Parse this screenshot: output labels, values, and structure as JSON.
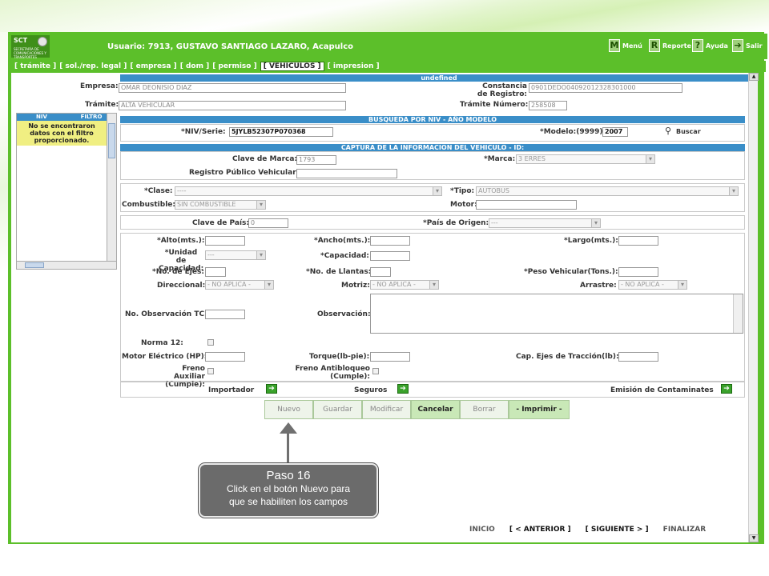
{
  "header": {
    "logo_text": "SCT",
    "logo_sub": "SECRETARÍA DE COMUNICACIONES Y TRANSPORTES",
    "user_text": "Usuario: 7913, GUSTAVO SANTIAGO LAZARO, Acapulco",
    "buttons": [
      {
        "icon": "M",
        "label": "Menú"
      },
      {
        "icon": "R",
        "label": "Reporte"
      },
      {
        "icon": "?",
        "label": "Ayuda"
      },
      {
        "icon": "➔",
        "label": "Salir"
      }
    ]
  },
  "tabs": [
    "[ trámite ]",
    "[ sol./rep. legal ]",
    "[ empresa ]",
    "[ dom ]",
    "[ permiso ]",
    "[ VEHICULOS ]",
    "[ impresion ]"
  ],
  "active_tab": "[ VEHICULOS ]",
  "undefined_bar": "undefined",
  "top": {
    "empresa_label": "Empresa:",
    "empresa_value": "OMAR DEONISIO DIAZ",
    "tramite_label": "Trámite:",
    "tramite_value": "ALTA VEHICULAR",
    "constancia_label": "Constancia de Registro:",
    "constancia_value": "0901DEDO04092012328301000",
    "tramite_num_label": "Trámite Número:",
    "tramite_num_value": "258508"
  },
  "left_panel": {
    "col1": "NIV",
    "col2": "FILTRO",
    "message": "No se encontraron datos con el filtro proporcionado."
  },
  "busqueda": {
    "title": "BUSQUEDA POR NIV - AÑO MODELO",
    "niv_label": "*NIV/Serie:",
    "niv_value": "5JYLB52307P070368",
    "modelo_label": "*Modelo:(9999)",
    "modelo_value": "2007",
    "buscar_label": "Buscar"
  },
  "captura": {
    "title": "CAPTURA DE LA INFORMACION DEL VEHICULO          - ID:",
    "clave_marca_label": "Clave de Marca:",
    "clave_marca_value": "1793",
    "marca_label": "*Marca:",
    "marca_value": "3 ERRES",
    "registro_label": "Registro Público Vehicular:",
    "clase_label": "*Clase:",
    "clase_value": "----",
    "tipo_label": "*Tipo:",
    "tipo_value": "AUTOBUS",
    "combustible_label": "Combustible:",
    "combustible_value": "SIN COMBUSTIBLE",
    "motor_label": "Motor:",
    "clave_pais_label": "Clave de País:",
    "clave_pais_value": "0",
    "pais_origen_label": "*País de Origen:",
    "pais_origen_value": "---",
    "alto_label": "*Alto(mts.):",
    "ancho_label": "*Ancho(mts.):",
    "largo_label": "*Largo(mts.):",
    "unidad_label": "*Unidad de Capacidad:",
    "unidad_value": "---",
    "capacidad_label": "*Capacidad:",
    "ejes_label": "*No. de Ejes:",
    "llantas_label": "*No. de Llantas:",
    "peso_label": "*Peso Vehicular(Tons.):",
    "direccional_label": "Direccional:",
    "direccional_value": "- NO APLICA -",
    "motriz_label": "Motriz:",
    "motriz_value": "- NO APLICA -",
    "arrastre_label": "Arrastre:",
    "arrastre_value": "- NO APLICA -",
    "obs_tc_label": "No. Observación TC:",
    "obs_label": "Observación:",
    "norma_label": "Norma 12:",
    "motor_elec_label": "Motor Eléctrico (HP):",
    "torque_label": "Torque(lb-pie):",
    "cap_ejes_label": "Cap. Ejes de Tracción(lb):",
    "freno_aux_label": "Freno Auxiliar (Cumple):",
    "freno_anti_label": "Freno Antibloqueo (Cumple):",
    "importador_label": "Importador",
    "seguros_label": "Seguros",
    "emision_label": "Emisión de Contaminates"
  },
  "actions": [
    "Nuevo",
    "Guardar",
    "Modificar",
    "Cancelar",
    "Borrar",
    "- Imprimir -"
  ],
  "callout": {
    "title": "Paso 16",
    "line1": "Click en el botón Nuevo para",
    "line2": "que se habiliten los campos"
  },
  "footer": {
    "inicio": "INICIO",
    "anterior": "[ < ANTERIOR ]",
    "siguiente": "[ SIGUIENTE > ]",
    "finalizar": "FINALIZAR"
  }
}
